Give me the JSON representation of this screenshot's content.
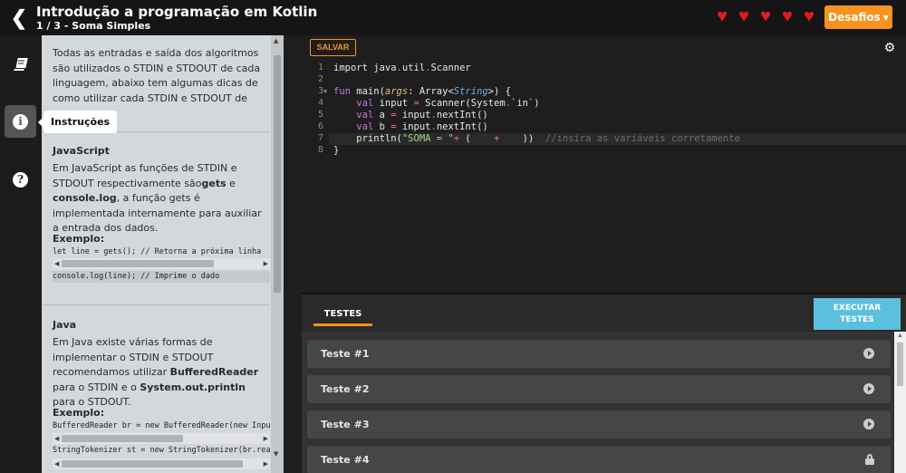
{
  "header": {
    "back_icon": "chevron-left-icon",
    "course_title": "Introdução a programação em Kotlin",
    "lesson_title": "1 / 3 - Soma Simples",
    "lives": 5,
    "desafios_label": "Desafios"
  },
  "sidebar": {
    "items": [
      {
        "icon": "book-icon",
        "label": ""
      },
      {
        "icon": "info-icon",
        "label": "Instruções",
        "active": true
      },
      {
        "icon": "help-icon",
        "label": ""
      }
    ],
    "tooltip": "Instruções"
  },
  "instructions": {
    "intro": "Todas as entradas e saída dos algoritmos são utilizados o STDIN e STDOUT de cada linguagem, abaixo tem algumas dicas de como utilizar cada STDIN e STDOUT de cada linguagem.",
    "js_title": "JavaScript",
    "js_text_1": "Em JavaScript as funções de STDIN e STDOUT respectivamente são",
    "js_gets": "gets",
    "js_and": " e ",
    "js_log": "console.log",
    "js_text_2": ", a função gets é implementada internamente para auxiliar a entrada dos dados.",
    "js_example_label": "Exemplo:",
    "js_code_1": "let line = gets(); // Retorna a próxima linha",
    "js_code_2": "console.log(line); // Imprime o dado",
    "java_title": "Java",
    "java_text_1": "Em Java existe várias formas de implementar o STDIN e STDOUT recomendamos utilizar ",
    "java_br": "BufferedReader",
    "java_text_2": " para o STDIN e o ",
    "java_println": "System.out.println",
    "java_text_3": " para o STDOUT.",
    "java_example_label": "Exemplo:",
    "java_code_1": "BufferedReader br = new BufferedReader(new InputStreamReader(System.in));",
    "java_code_2": "StringTokenizer st = new StringTokenizer(br.readLine());"
  },
  "editor": {
    "save_label": "SALVAR",
    "settings_icon": "gear-icon",
    "line_numbers": [
      "1",
      "2",
      "3",
      "4",
      "5",
      "6",
      "7",
      "8"
    ]
  },
  "tests": {
    "tab_label": "TESTES",
    "run_label_1": "EXECUTAR",
    "run_label_2": "TESTES",
    "items": [
      {
        "label": "Teste #1",
        "icon": "play-icon"
      },
      {
        "label": "Teste #2",
        "icon": "play-icon"
      },
      {
        "label": "Teste #3",
        "icon": "play-icon"
      },
      {
        "label": "Teste #4",
        "icon": "lock-icon"
      }
    ]
  },
  "colors": {
    "accent": "#f7921e",
    "run_button": "#5bc0de",
    "heart": "#e01b24"
  }
}
